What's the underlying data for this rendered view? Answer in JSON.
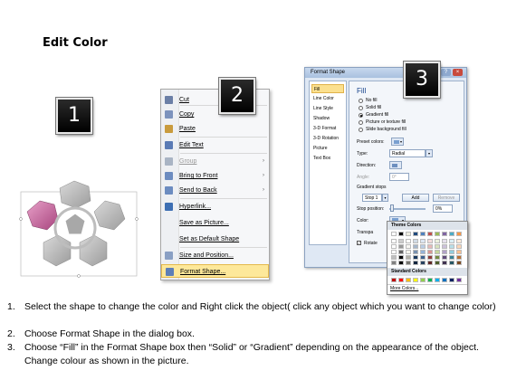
{
  "title": "Edit Color",
  "steps": [
    "1",
    "2",
    "3"
  ],
  "context_menu": {
    "items": [
      {
        "label": "Cut",
        "icon": "scissors-icon",
        "disabled": false,
        "submenu": false
      },
      {
        "label": "Copy",
        "icon": "copy-icon",
        "disabled": false,
        "submenu": false
      },
      {
        "label": "Paste",
        "icon": "paste-icon",
        "disabled": false,
        "submenu": false
      },
      {
        "label": "Edit Text",
        "icon": "edit-text-icon",
        "disabled": false,
        "submenu": false
      },
      {
        "label": "Group",
        "icon": "group-icon",
        "disabled": true,
        "submenu": true
      },
      {
        "label": "Bring to Front",
        "icon": "bring-to-front-icon",
        "disabled": false,
        "submenu": true
      },
      {
        "label": "Send to Back",
        "icon": "send-to-back-icon",
        "disabled": false,
        "submenu": true
      },
      {
        "label": "Hyperlink...",
        "icon": "hyperlink-icon",
        "disabled": false,
        "submenu": false
      },
      {
        "label": "Save as Picture...",
        "icon": "",
        "disabled": false,
        "submenu": false
      },
      {
        "label": "Set as Default Shape",
        "icon": "",
        "disabled": false,
        "submenu": false
      },
      {
        "label": "Size and Position...",
        "icon": "size-position-icon",
        "disabled": false,
        "submenu": false
      },
      {
        "label": "Format Shape...",
        "icon": "format-shape-icon",
        "disabled": false,
        "submenu": false,
        "highlighted": true
      }
    ],
    "arrow": "›"
  },
  "dialog": {
    "title": "Format Shape",
    "nav": [
      "Fill",
      "Line Color",
      "Line Style",
      "Shadow",
      "3-D Format",
      "3-D Rotation",
      "Picture",
      "Text Box"
    ],
    "selected_nav": "Fill",
    "section": "Fill",
    "options": [
      {
        "label": "No fill",
        "checked": false
      },
      {
        "label": "Solid fill",
        "checked": false
      },
      {
        "label": "Gradient fill",
        "checked": true
      },
      {
        "label": "Picture or texture fill",
        "checked": false
      },
      {
        "label": "Slide background fill",
        "checked": false
      }
    ],
    "preset_colors": "Preset colors:",
    "type_label": "Type:",
    "type_value": "Radial",
    "direction_label": "Direction:",
    "angle_label": "Angle:",
    "angle_value": "0°",
    "gradient_stops": "Gradient stops",
    "stop_value": "Stop 1",
    "add": "Add",
    "remove": "Remove",
    "stop_position_label": "Stop position:",
    "stop_position_value": "0%",
    "color_label": "Color:",
    "transparency_label": "Transpa",
    "rotate_label": "Rotate"
  },
  "palette": {
    "theme_header": "Theme Colors",
    "standard_header": "Standard Colors",
    "more": "More Colors...",
    "theme_top": [
      "#ffffff",
      "#000000",
      "#eeece1",
      "#1f497d",
      "#4f81bd",
      "#c0504d",
      "#9bbb59",
      "#8064a2",
      "#4bacc6",
      "#f79646"
    ],
    "standard": [
      "#c00000",
      "#ff0000",
      "#ffc000",
      "#ffff00",
      "#92d050",
      "#00b050",
      "#00b0f0",
      "#0070c0",
      "#002060",
      "#7030a0"
    ]
  },
  "instructions": [
    {
      "n": "1.",
      "text": "Select the shape to change the color and Right click the object( click any object which you want to change color)"
    },
    {
      "n": "2.",
      "text": "Choose Format Shape in the dialog box."
    },
    {
      "n": "3.",
      "text": "Choose “Fill” in the Format Shape box then “Solid” or “Gradient” depending on the appearance of the object. Change colour as shown in the picture."
    }
  ],
  "colors": {
    "highlight_shape": "#c0639a",
    "shape_gray": "#b5b5b5",
    "menu_highlight": "#fde89a"
  }
}
